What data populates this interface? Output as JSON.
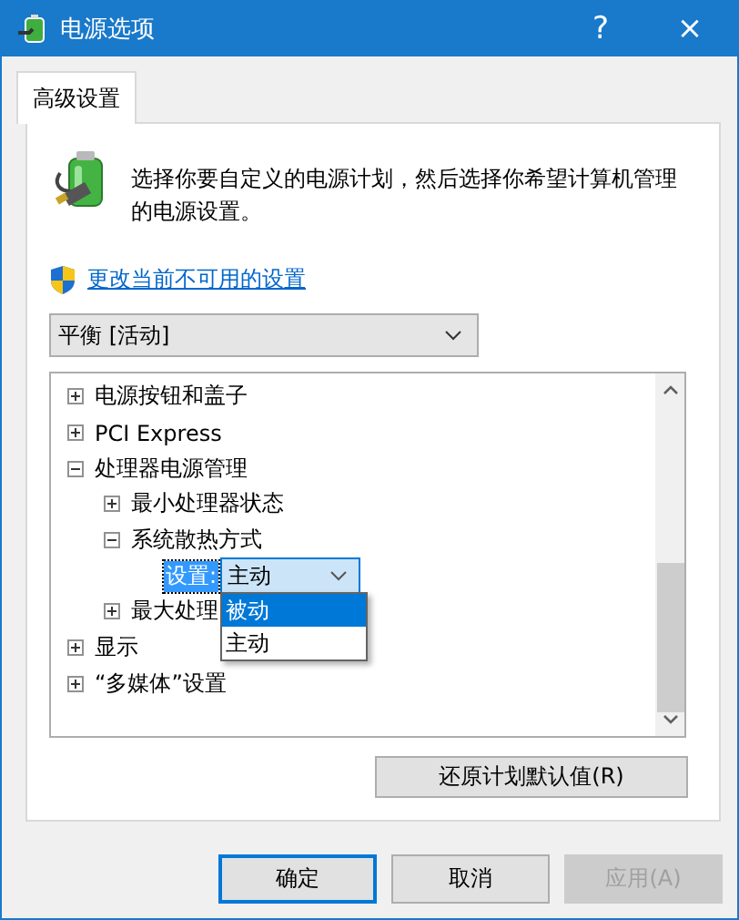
{
  "window": {
    "title": "电源选项",
    "help": "?",
    "close": "×"
  },
  "tabs": [
    {
      "label": "高级设置",
      "selected": true
    }
  ],
  "intro": "选择你要自定义的电源计划，然后选择你希望计算机管理的电源设置。",
  "link": "更改当前不可用的设置",
  "plan": {
    "value": "平衡 [活动]"
  },
  "tree": {
    "items": [
      {
        "kind": "node",
        "label": "电源按钮和盖子",
        "expanded": false
      },
      {
        "kind": "node",
        "label": "PCI Express",
        "expanded": false
      },
      {
        "kind": "node",
        "label": "处理器电源管理",
        "expanded": true,
        "children": [
          {
            "kind": "node",
            "label": "最小处理器状态",
            "expanded": false
          },
          {
            "kind": "node",
            "label": "系统散热方式",
            "expanded": true,
            "children": [
              {
                "kind": "setting",
                "label": "设置:",
                "value": "主动",
                "options": [
                  {
                    "label": "被动",
                    "highlighted": true
                  },
                  {
                    "label": "主动",
                    "highlighted": false
                  }
                ]
              }
            ]
          },
          {
            "kind": "node",
            "label": "最大处理",
            "expanded": false
          }
        ]
      },
      {
        "kind": "node",
        "label": "显示",
        "expanded": false
      },
      {
        "kind": "node",
        "label": "“多媒体”设置",
        "expanded": false
      }
    ]
  },
  "restore_button": "还原计划默认值(R)",
  "buttons": [
    {
      "label": "确定",
      "default": true,
      "disabled": false
    },
    {
      "label": "取消",
      "default": false,
      "disabled": false
    },
    {
      "label": "应用(A)",
      "default": false,
      "disabled": true
    }
  ]
}
